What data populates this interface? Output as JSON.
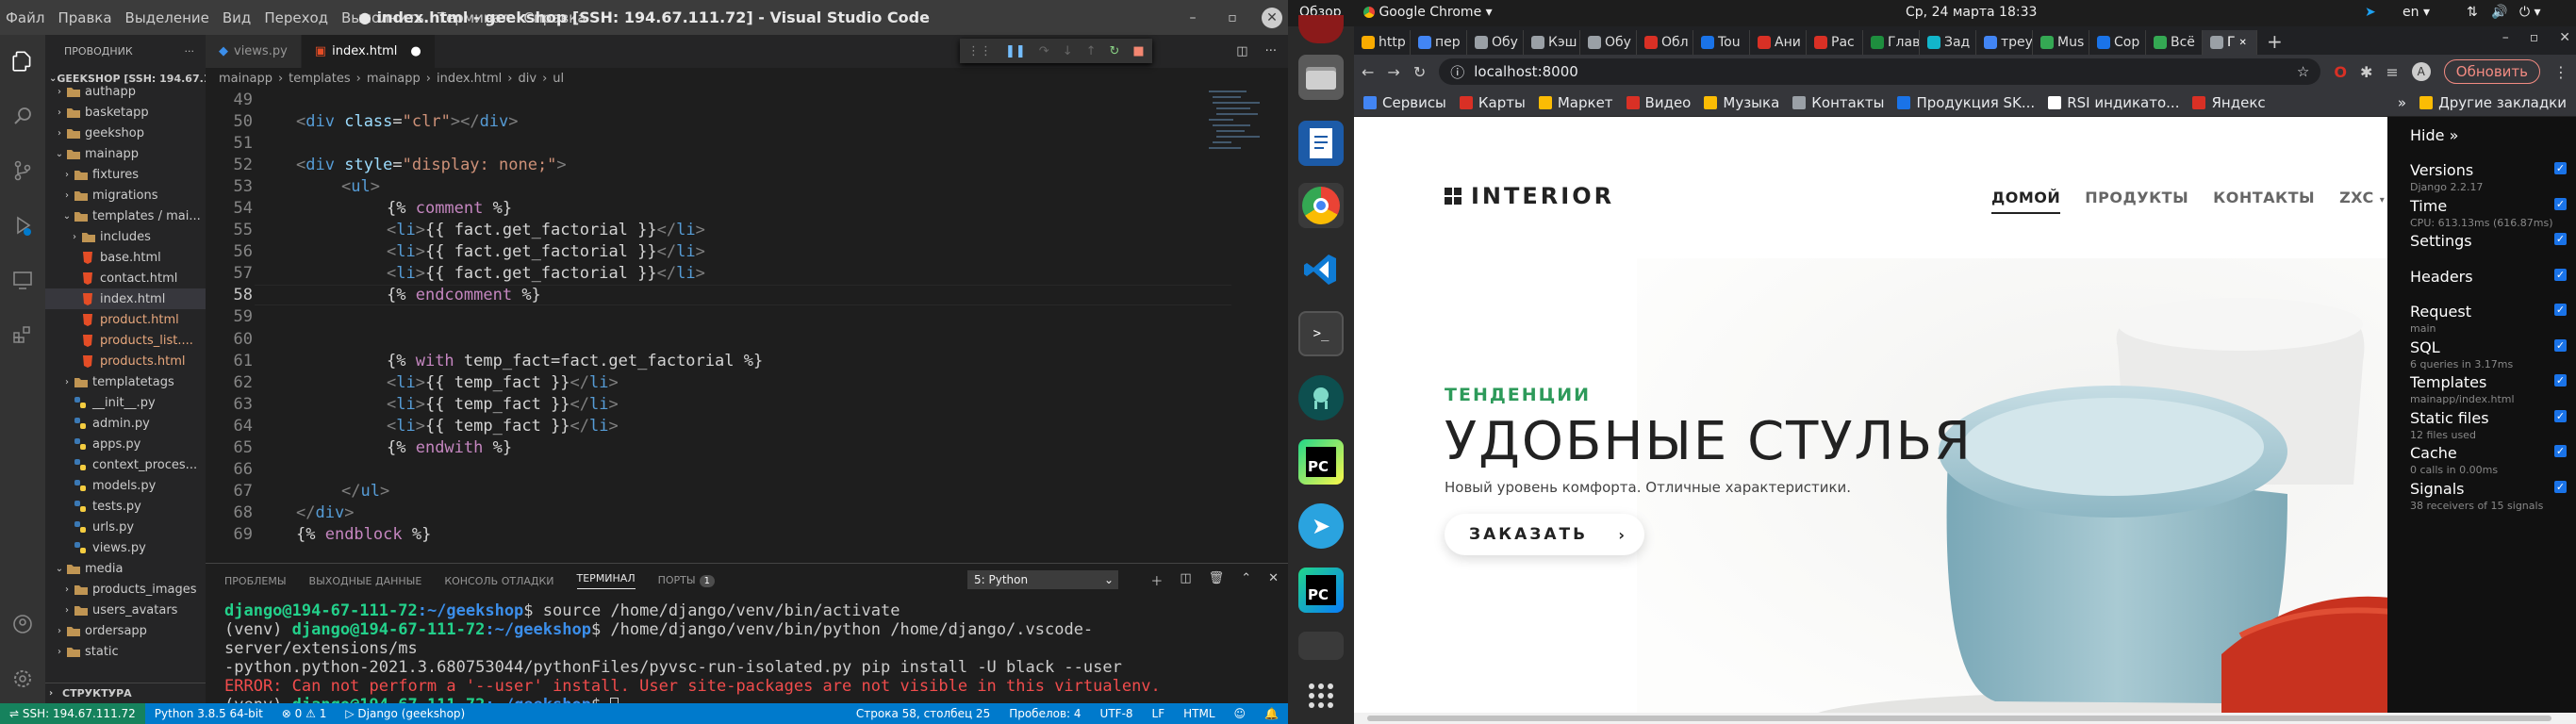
{
  "vscode": {
    "window_title": "● index.html - geekshop [SSH: 194.67.111.72] - Visual Studio Code",
    "menu": [
      "Файл",
      "Правка",
      "Выделение",
      "Вид",
      "Переход",
      "Выполнить",
      "Терминал",
      "Справка"
    ],
    "explorer_title": "ПРОВОДНИК",
    "root": "GEEKSHOP [SSH: 194.67.1...",
    "tree": [
      {
        "label": "authapp",
        "indent": 1,
        "kind": "folder-closed"
      },
      {
        "label": "basketapp",
        "indent": 1,
        "kind": "folder-closed"
      },
      {
        "label": "geekshop",
        "indent": 1,
        "kind": "folder-closed"
      },
      {
        "label": "mainapp",
        "indent": 1,
        "kind": "folder-open"
      },
      {
        "label": "fixtures",
        "indent": 2,
        "kind": "folder-closed"
      },
      {
        "label": "migrations",
        "indent": 2,
        "kind": "folder-closed"
      },
      {
        "label": "templates / mai...",
        "indent": 2,
        "kind": "folder-open"
      },
      {
        "label": "includes",
        "indent": 3,
        "kind": "folder-closed"
      },
      {
        "label": "base.html",
        "indent": 3,
        "kind": "html"
      },
      {
        "label": "contact.html",
        "indent": 3,
        "kind": "html"
      },
      {
        "label": "index.html",
        "indent": 3,
        "kind": "html",
        "selected": true
      },
      {
        "label": "product.html",
        "indent": 3,
        "kind": "html"
      },
      {
        "label": "products_list....",
        "indent": 3,
        "kind": "html"
      },
      {
        "label": "products.html",
        "indent": 3,
        "kind": "html"
      },
      {
        "label": "templatetags",
        "indent": 2,
        "kind": "folder-closed"
      },
      {
        "label": "__init__.py",
        "indent": 2,
        "kind": "py"
      },
      {
        "label": "admin.py",
        "indent": 2,
        "kind": "py"
      },
      {
        "label": "apps.py",
        "indent": 2,
        "kind": "py"
      },
      {
        "label": "context_proces...",
        "indent": 2,
        "kind": "py"
      },
      {
        "label": "models.py",
        "indent": 2,
        "kind": "py"
      },
      {
        "label": "tests.py",
        "indent": 2,
        "kind": "py"
      },
      {
        "label": "urls.py",
        "indent": 2,
        "kind": "py"
      },
      {
        "label": "views.py",
        "indent": 2,
        "kind": "py"
      },
      {
        "label": "media",
        "indent": 1,
        "kind": "folder-open"
      },
      {
        "label": "products_images",
        "indent": 2,
        "kind": "folder-closed"
      },
      {
        "label": "users_avatars",
        "indent": 2,
        "kind": "folder-closed"
      },
      {
        "label": "ordersapp",
        "indent": 1,
        "kind": "folder-closed"
      },
      {
        "label": "static",
        "indent": 1,
        "kind": "folder-closed"
      }
    ],
    "structure": "СТРУКТУРА",
    "tabs": [
      {
        "label": "views.py",
        "kind": "py"
      },
      {
        "label": "index.html",
        "kind": "html",
        "modified": true
      }
    ],
    "breadcrumbs": [
      "mainapp",
      "templates",
      "mainapp",
      "index.html",
      "div",
      "ul"
    ],
    "code": [
      {
        "n": "49",
        "parts": []
      },
      {
        "n": "50",
        "indent": 0,
        "parts": [
          [
            "tg",
            "<"
          ],
          [
            "tn",
            "div"
          ],
          [
            "tx",
            " "
          ],
          [
            "an",
            "class"
          ],
          [
            "tx",
            "="
          ],
          [
            "av",
            "\"clr\""
          ],
          [
            "tg",
            "></"
          ],
          [
            "tn",
            "div"
          ],
          [
            "tg",
            ">"
          ]
        ]
      },
      {
        "n": "51",
        "parts": []
      },
      {
        "n": "52",
        "indent": 0,
        "parts": [
          [
            "tg",
            "<"
          ],
          [
            "tn",
            "div"
          ],
          [
            "tx",
            " "
          ],
          [
            "an",
            "style"
          ],
          [
            "tx",
            "="
          ],
          [
            "av",
            "\"display: none;\""
          ],
          [
            "tg",
            ">"
          ]
        ]
      },
      {
        "n": "53",
        "indent": 1,
        "parts": [
          [
            "tg",
            "<"
          ],
          [
            "tn",
            "ul"
          ],
          [
            "tg",
            ">"
          ]
        ]
      },
      {
        "n": "54",
        "indent": 2,
        "parts": [
          [
            "tx",
            "{% "
          ],
          [
            "kw",
            "comment"
          ],
          [
            "tx",
            " %}"
          ]
        ]
      },
      {
        "n": "55",
        "indent": 2,
        "parts": [
          [
            "tg",
            "<"
          ],
          [
            "tn",
            "li"
          ],
          [
            "tg",
            ">"
          ],
          [
            "tx",
            "{{ fact.get_factorial }}"
          ],
          [
            "tg",
            "</"
          ],
          [
            "tn",
            "li"
          ],
          [
            "tg",
            ">"
          ]
        ]
      },
      {
        "n": "56",
        "indent": 2,
        "parts": [
          [
            "tg",
            "<"
          ],
          [
            "tn",
            "li"
          ],
          [
            "tg",
            ">"
          ],
          [
            "tx",
            "{{ fact.get_factorial }}"
          ],
          [
            "tg",
            "</"
          ],
          [
            "tn",
            "li"
          ],
          [
            "tg",
            ">"
          ]
        ]
      },
      {
        "n": "57",
        "indent": 2,
        "parts": [
          [
            "tg",
            "<"
          ],
          [
            "tn",
            "li"
          ],
          [
            "tg",
            ">"
          ],
          [
            "tx",
            "{{ fact.get_factorial }}"
          ],
          [
            "tg",
            "</"
          ],
          [
            "tn",
            "li"
          ],
          [
            "tg",
            ">"
          ]
        ]
      },
      {
        "n": "58",
        "indent": 2,
        "current": true,
        "parts": [
          [
            "tx",
            "{% "
          ],
          [
            "kw",
            "endcomment"
          ],
          [
            "tx",
            " %}"
          ]
        ]
      },
      {
        "n": "59",
        "parts": []
      },
      {
        "n": "60",
        "parts": []
      },
      {
        "n": "61",
        "indent": 2,
        "parts": [
          [
            "tx",
            "{% "
          ],
          [
            "kw",
            "with"
          ],
          [
            "tx",
            " temp_fact=fact.get_factorial %}"
          ]
        ]
      },
      {
        "n": "62",
        "indent": 2,
        "parts": [
          [
            "tg",
            "<"
          ],
          [
            "tn",
            "li"
          ],
          [
            "tg",
            ">"
          ],
          [
            "tx",
            "{{ temp_fact }}"
          ],
          [
            "tg",
            "</"
          ],
          [
            "tn",
            "li"
          ],
          [
            "tg",
            ">"
          ]
        ]
      },
      {
        "n": "63",
        "indent": 2,
        "parts": [
          [
            "tg",
            "<"
          ],
          [
            "tn",
            "li"
          ],
          [
            "tg",
            ">"
          ],
          [
            "tx",
            "{{ temp_fact }}"
          ],
          [
            "tg",
            "</"
          ],
          [
            "tn",
            "li"
          ],
          [
            "tg",
            ">"
          ]
        ]
      },
      {
        "n": "64",
        "indent": 2,
        "parts": [
          [
            "tg",
            "<"
          ],
          [
            "tn",
            "li"
          ],
          [
            "tg",
            ">"
          ],
          [
            "tx",
            "{{ temp_fact }}"
          ],
          [
            "tg",
            "</"
          ],
          [
            "tn",
            "li"
          ],
          [
            "tg",
            ">"
          ]
        ]
      },
      {
        "n": "65",
        "indent": 2,
        "parts": [
          [
            "tx",
            "{% "
          ],
          [
            "kw",
            "endwith"
          ],
          [
            "tx",
            " %}"
          ]
        ]
      },
      {
        "n": "66",
        "parts": []
      },
      {
        "n": "67",
        "indent": 1,
        "parts": [
          [
            "tg",
            "</"
          ],
          [
            "tn",
            "ul"
          ],
          [
            "tg",
            ">"
          ]
        ]
      },
      {
        "n": "68",
        "indent": 0,
        "parts": [
          [
            "tg",
            "</"
          ],
          [
            "tn",
            "div"
          ],
          [
            "tg",
            ">"
          ]
        ]
      },
      {
        "n": "69",
        "indent": 0,
        "parts": [
          [
            "tx",
            "{% "
          ],
          [
            "kw",
            "endblock"
          ],
          [
            "tx",
            " %}"
          ]
        ]
      }
    ],
    "panel_tabs": [
      "ПРОБЛЕМЫ",
      "ВЫХОДНЫЕ ДАННЫЕ",
      "КОНСОЛЬ ОТЛАДКИ",
      "ТЕРМИНАЛ",
      "ПОРТЫ"
    ],
    "ports_badge": "1",
    "terminal_select": "5: Python",
    "terminal": {
      "l1_user": "django@194-67-111-72",
      "l1_path": ":~/geekshop",
      "l1_cmd": "$ source /home/django/venv/bin/activate",
      "l2_venv": "(venv) ",
      "l2_user": "django@194-67-111-72",
      "l2_path": ":~/geekshop",
      "l2_cmd": "$ /home/django/venv/bin/python /home/django/.vscode-server/extensions/ms",
      "l3": "-python.python-2021.3.680753044/pythonFiles/pyvsc-run-isolated.py pip install -U black --user",
      "l4": "ERROR: Can not perform a '--user' install. User site-packages are not visible in this virtualenv.",
      "l5_venv": "(venv) ",
      "l5_user": "django@194-67-111-72",
      "l5_path": ":~/geekshop",
      "l5_cmd": "$ "
    },
    "status": {
      "remote": "SSH: 194.67.111.72",
      "python": "Python 3.8.5 64-bit",
      "errors": "0",
      "warnings": "1",
      "env": "Django (geekshop)",
      "position": "Строка 58, столбец 25",
      "spaces": "Пробелов: 4",
      "encoding": "UTF-8",
      "eol": "LF",
      "lang": "HTML"
    }
  },
  "gnome": {
    "activities": "Обзор",
    "app": "Google Chrome",
    "datetime": "Ср, 24 марта  18:33",
    "lang": "en"
  },
  "dock": [
    "firefox",
    "files",
    "writer",
    "chrome",
    "vscode",
    "terminal",
    "gitkraken",
    "pycharm",
    "telegram",
    "pycharm-2",
    "apps-grid"
  ],
  "chrome": {
    "tabs": [
      {
        "label": "http",
        "color": "#f9ab00"
      },
      {
        "label": "пер",
        "color": "#4285f4"
      },
      {
        "label": "Обу",
        "color": "#9aa0a6"
      },
      {
        "label": "Кэш",
        "color": "#9aa0a6"
      },
      {
        "label": "Обу",
        "color": "#9aa0a6"
      },
      {
        "label": "Обл",
        "color": "#d93025"
      },
      {
        "label": "Tou",
        "color": "#1a73e8"
      },
      {
        "label": "Ани",
        "color": "#d93025"
      },
      {
        "label": "Рас",
        "color": "#d93025"
      },
      {
        "label": "Глав",
        "color": "#1e8e3e"
      },
      {
        "label": "Зад",
        "color": "#12b5cb"
      },
      {
        "label": "треу",
        "color": "#4285f4"
      },
      {
        "label": "Mus",
        "color": "#34a853"
      },
      {
        "label": "Сор",
        "color": "#1a73e8"
      },
      {
        "label": "Всё",
        "color": "#34a853"
      },
      {
        "label": "Г",
        "color": "#9aa0a6",
        "active": true
      }
    ],
    "url": "localhost:8000",
    "update": "Обновить",
    "bookmarks": [
      {
        "label": "Сервисы",
        "color": "#4285f4"
      },
      {
        "label": "Карты",
        "color": "#d93025"
      },
      {
        "label": "Маркет",
        "color": "#fbbc04"
      },
      {
        "label": "Видео",
        "color": "#d93025"
      },
      {
        "label": "Музыка",
        "color": "#fbbc04"
      },
      {
        "label": "Контакты",
        "color": "#9aa0a6"
      },
      {
        "label": "Продукция SK...",
        "color": "#1a73e8"
      },
      {
        "label": "RSI индикато...",
        "color": "#ffffff"
      },
      {
        "label": "Яндекс",
        "color": "#d93025"
      }
    ],
    "other_bookmarks": "Другие закладки"
  },
  "site": {
    "logo": "INTERIOR",
    "nav": [
      "ДОМОЙ",
      "ПРОДУКТЫ",
      "КОНТАКТЫ",
      "ZXC"
    ],
    "subtitle": "ТЕНДЕНЦИИ",
    "title": "УДОБНЫЕ СТУЛЬЯ",
    "desc": "Новый уровень комфорта. Отличные характеристики.",
    "cta": "ЗАКАЗАТЬ"
  },
  "djdt": {
    "hide": "Hide »",
    "panels": [
      {
        "t": "Versions",
        "s": "Django 2.2.17"
      },
      {
        "t": "Time",
        "s": "CPU: 613.13ms (616.87ms)"
      },
      {
        "t": "Settings",
        "s": ""
      },
      {
        "t": "Headers",
        "s": ""
      },
      {
        "t": "Request",
        "s": "main"
      },
      {
        "t": "SQL",
        "s": "6 queries in 3.17ms"
      },
      {
        "t": "Templates",
        "s": "mainapp/index.html"
      },
      {
        "t": "Static files",
        "s": "12 files used"
      },
      {
        "t": "Cache",
        "s": "0 calls in 0.00ms"
      },
      {
        "t": "Signals",
        "s": "38 receivers of 15 signals"
      }
    ]
  },
  "colors": {
    "vscode_status": "#007acc",
    "remote": "#16825d",
    "site_accent": "#2d9a5a",
    "debug_bar": "#111111"
  }
}
